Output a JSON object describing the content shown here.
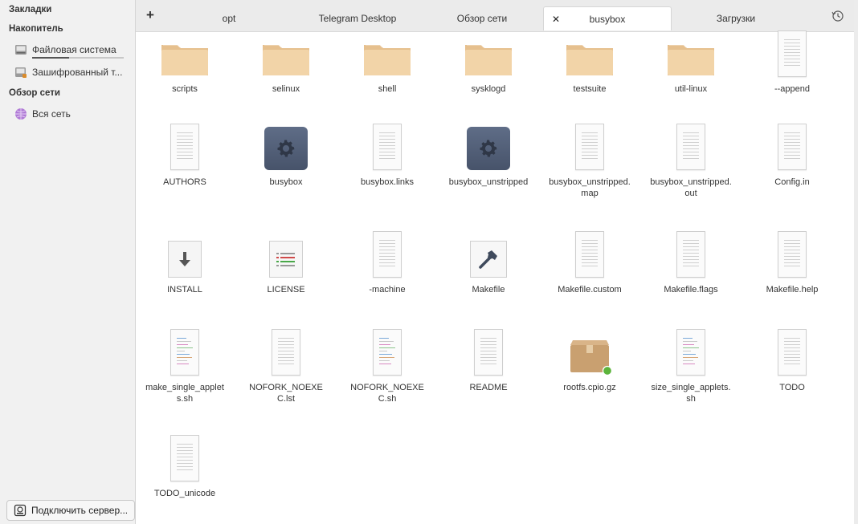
{
  "sidebar": {
    "bookmarks_heading": "Закладки",
    "devices_heading": "Накопитель",
    "devices": [
      {
        "label": "Файловая система",
        "icon": "drive-icon",
        "usage_fraction": 0.4
      },
      {
        "label": "Зашифрованный т...",
        "icon": "encrypted-drive-icon"
      }
    ],
    "network_heading": "Обзор сети",
    "network": [
      {
        "label": "Вся сеть",
        "icon": "network-icon"
      }
    ],
    "connect_server": "Подключить сервер..."
  },
  "tabs": {
    "add_label": "+",
    "items": [
      {
        "label": "opt"
      },
      {
        "label": "Telegram Desktop"
      },
      {
        "label": "Обзор сети"
      },
      {
        "label": "busybox",
        "active": true
      },
      {
        "label": "Загрузки"
      }
    ],
    "close_glyph": "✕"
  },
  "files": [
    {
      "name": "scripts",
      "type": "folder"
    },
    {
      "name": "selinux",
      "type": "folder"
    },
    {
      "name": "shell",
      "type": "folder"
    },
    {
      "name": "sysklogd",
      "type": "folder"
    },
    {
      "name": "testsuite",
      "type": "folder"
    },
    {
      "name": "util-linux",
      "type": "folder"
    },
    {
      "name": "--append",
      "type": "text"
    },
    {
      "name": "AUTHORS",
      "type": "text"
    },
    {
      "name": "busybox",
      "type": "executable"
    },
    {
      "name": "busybox.links",
      "type": "text"
    },
    {
      "name": "busybox_unstripped",
      "type": "executable"
    },
    {
      "name": "busybox_unstripped.map",
      "type": "text"
    },
    {
      "name": "busybox_unstripped.out",
      "type": "text"
    },
    {
      "name": "Config.in",
      "type": "text"
    },
    {
      "name": "INSTALL",
      "type": "install"
    },
    {
      "name": "LICENSE",
      "type": "license"
    },
    {
      "name": "-machine",
      "type": "text"
    },
    {
      "name": "Makefile",
      "type": "makefile"
    },
    {
      "name": "Makefile.custom",
      "type": "text"
    },
    {
      "name": "Makefile.flags",
      "type": "text"
    },
    {
      "name": "Makefile.help",
      "type": "text"
    },
    {
      "name": "make_single_applets.sh",
      "type": "script"
    },
    {
      "name": "NOFORK_NOEXEC.lst",
      "type": "text"
    },
    {
      "name": "NOFORK_NOEXEC.sh",
      "type": "script"
    },
    {
      "name": "README",
      "type": "text"
    },
    {
      "name": "rootfs.cpio.gz",
      "type": "archive"
    },
    {
      "name": "size_single_applets.sh",
      "type": "script"
    },
    {
      "name": "TODO",
      "type": "text"
    },
    {
      "name": "TODO_unicode",
      "type": "text"
    }
  ],
  "colors": {
    "folder": "#f2d4a8",
    "folder_dark": "#e6c08e",
    "executable": "#4f5b73",
    "archive": "#c9a070",
    "badge_green": "#5cb43c"
  }
}
